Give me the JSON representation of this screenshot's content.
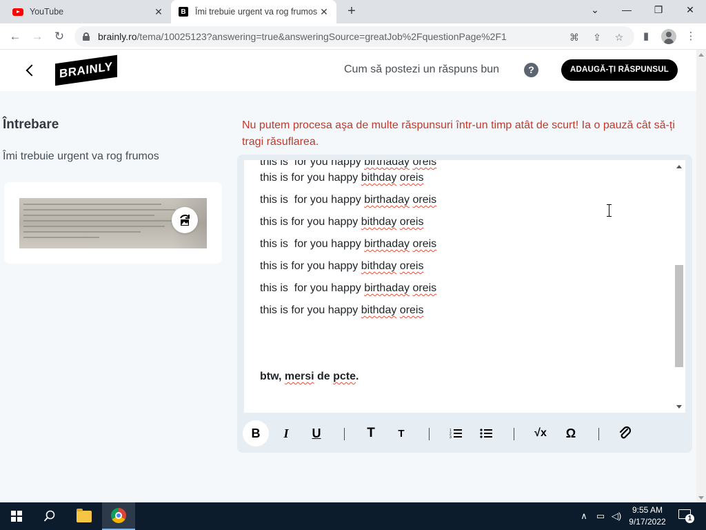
{
  "browser": {
    "tabs": [
      {
        "title": "YouTube",
        "favicon": "youtube-icon"
      },
      {
        "title": "Îmi trebuie urgent va rog frumos",
        "favicon": "brainly-icon",
        "favicon_letter": "B"
      }
    ],
    "new_tab": "+",
    "window_controls": {
      "list": "⌄",
      "minimize": "—",
      "maximize": "❐",
      "close": "✕"
    },
    "url_host": "brainly.ro",
    "url_path": "/tema/10025123?answering=true&answeringSource=greatJob%2FquestionPage%2F1"
  },
  "header": {
    "logo": "BRAINLY",
    "help_text": "Cum să postezi un răspuns bun",
    "help_icon": "?",
    "add_answer_button": "ADAUGĂ-ȚI RĂSPUNSUL"
  },
  "question": {
    "heading": "Întrebare",
    "text": "Îmi trebuie urgent va rog frumos"
  },
  "error_message": "Nu putem procesa aşa de multe răspunsuri într-un timp atât de scurt! Ia o pauză cât să-ți tragi răsuflarea.",
  "editor": {
    "lines": [
      [
        "this is for you happy ",
        "bithday",
        " ",
        "oreis"
      ],
      [
        "this is  for you happy ",
        "birthaday",
        " ",
        "oreis"
      ],
      [
        "this is for you happy ",
        "bithday",
        " ",
        "oreis"
      ],
      [
        "this is  for you happy ",
        "birthaday",
        " ",
        "oreis"
      ],
      [
        "this is for you happy ",
        "bithday",
        " ",
        "oreis"
      ],
      [
        "this is  for you happy ",
        "birthaday",
        " ",
        "oreis"
      ],
      [
        "this is for you happy ",
        "bithday",
        " ",
        "oreis"
      ]
    ],
    "closing_line": {
      "pre": "btw, ",
      "w1": "mersi",
      "mid": " de ",
      "w2": "pcte",
      "post": "."
    }
  },
  "toolbar": {
    "bold": "B",
    "italic": "I",
    "underline": "U",
    "heading_large": "T",
    "heading_small": "T",
    "math": "√x",
    "symbol": "Ω"
  },
  "taskbar": {
    "time": "9:55 AM",
    "date": "9/17/2022",
    "notification_count": "1"
  }
}
